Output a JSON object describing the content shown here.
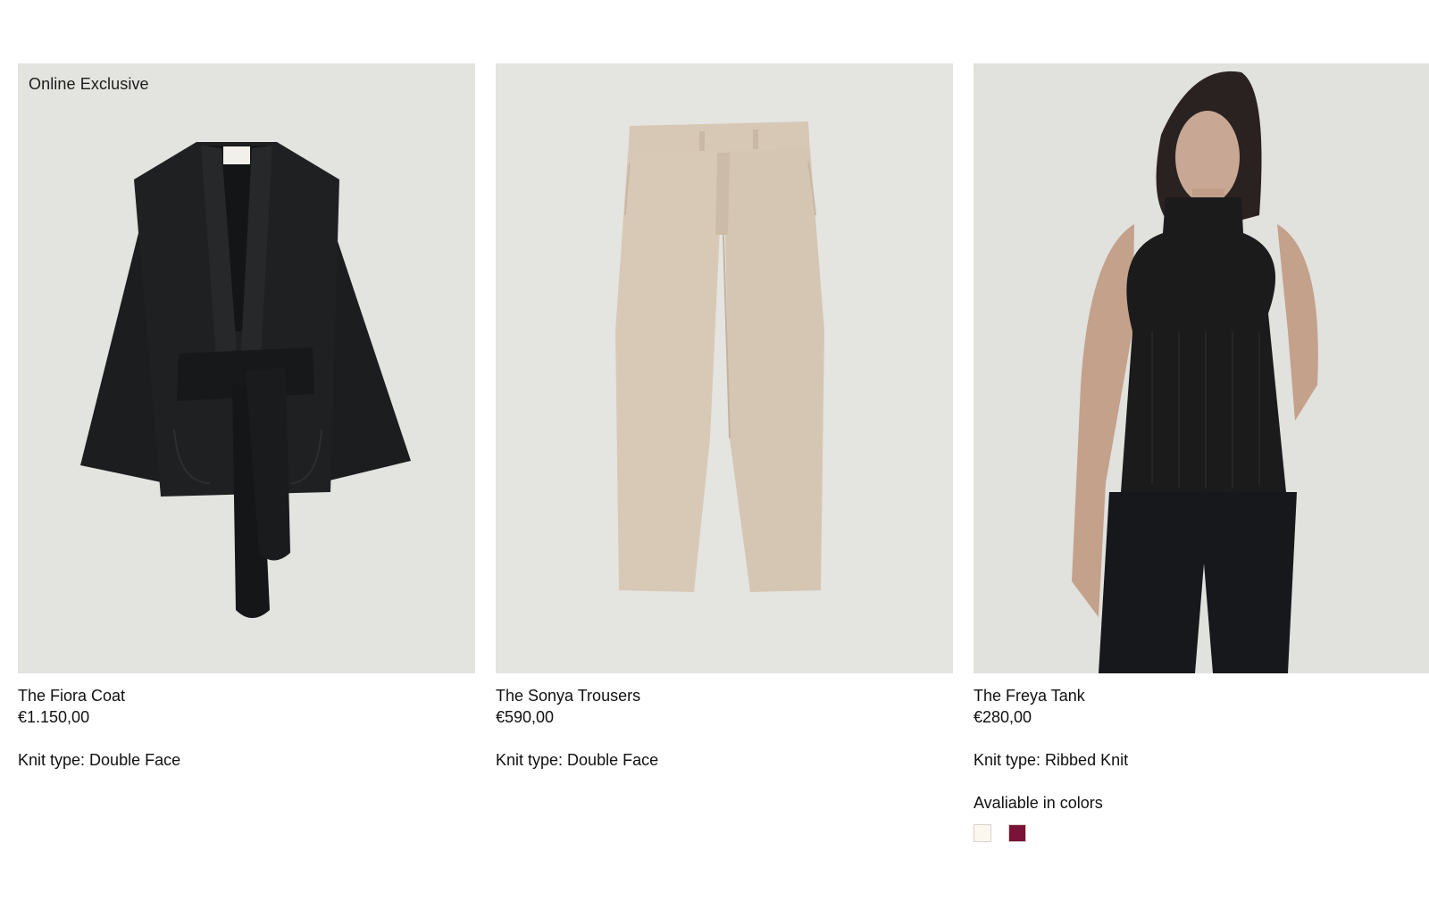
{
  "products": [
    {
      "badge": "Online Exclusive",
      "name": "The Fiora Coat",
      "price": "€1.150,00",
      "knit": "Knit type: Double Face",
      "image_icon": "black-belted-coat-image"
    },
    {
      "badge": "",
      "name": "The Sonya Trousers",
      "price": "€590,00",
      "knit": "Knit type: Double Face",
      "image_icon": "beige-trousers-image"
    },
    {
      "badge": "",
      "name": "The Freya Tank",
      "price": "€280,00",
      "knit": "Knit type: Ribbed Knit",
      "image_icon": "model-black-tank-image",
      "colors_label": "Avaliable in colors",
      "swatches": [
        {
          "color": "#fbf7ef",
          "name": "ivory"
        },
        {
          "color": "#7a1337",
          "name": "burgundy"
        }
      ]
    }
  ],
  "colors": {
    "image_background": "#e3e3df",
    "text": "#111111"
  }
}
